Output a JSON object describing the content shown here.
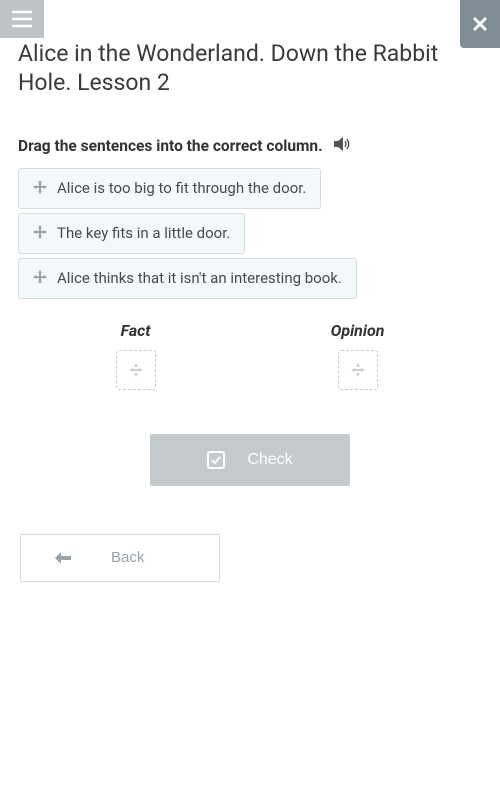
{
  "page": {
    "title": "Alice in the Wonderland. Down the Rabbit Hole. Lesson 2"
  },
  "exercise": {
    "instruction": "Drag the sentences into the correct column.",
    "sentences": [
      "Alice is too big to fit through the door.",
      "The key fits in a little door.",
      "Alice thinks that it isn't an interesting book."
    ],
    "columns": {
      "fact": "Fact",
      "opinion": "Opinion"
    }
  },
  "buttons": {
    "check": "Check",
    "back": "Back"
  }
}
